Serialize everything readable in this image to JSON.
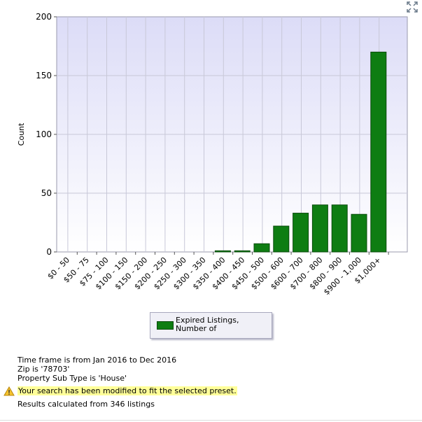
{
  "chart_data": {
    "type": "bar",
    "ylabel": "Count",
    "xlabel": "",
    "ylim": [
      0,
      200
    ],
    "yticks": [
      0,
      50,
      100,
      150,
      200
    ],
    "grid": true,
    "legend_position": "bottom-center",
    "categories": [
      "$0 - 50",
      "$50 - 75",
      "$75 - 100",
      "$100 - 150",
      "$150 - 200",
      "$200 - 250",
      "$250 - 300",
      "$300 - 350",
      "$350 - 400",
      "$400 - 450",
      "$450 - 500",
      "$500 - 600",
      "$600 - 700",
      "$700 - 800",
      "$800 - 900",
      "$900 - 1,000",
      "$1,000+"
    ],
    "series": [
      {
        "name": "Expired Listings, Number of",
        "values": [
          0,
          0,
          0,
          0,
          0,
          0,
          0,
          0,
          1,
          1,
          7,
          22,
          33,
          40,
          40,
          32,
          170
        ]
      }
    ],
    "colors": {
      "bar": "#0e7d12",
      "bar_edge": "#0a4a0c",
      "plot_bg_top": "#dcdcf7",
      "plot_bg_bottom": "#ffffff"
    }
  },
  "icons": {
    "expand": "expand-icon",
    "warning": "warning-icon"
  },
  "info": {
    "line1": "Time frame is from Jan 2016 to Dec 2016",
    "line2": "Zip is '78703'",
    "line3": "Property Sub Type is 'House'",
    "warning": "Your search has been modified to fit the selected preset.",
    "line5": "Results calculated from 346 listings"
  }
}
